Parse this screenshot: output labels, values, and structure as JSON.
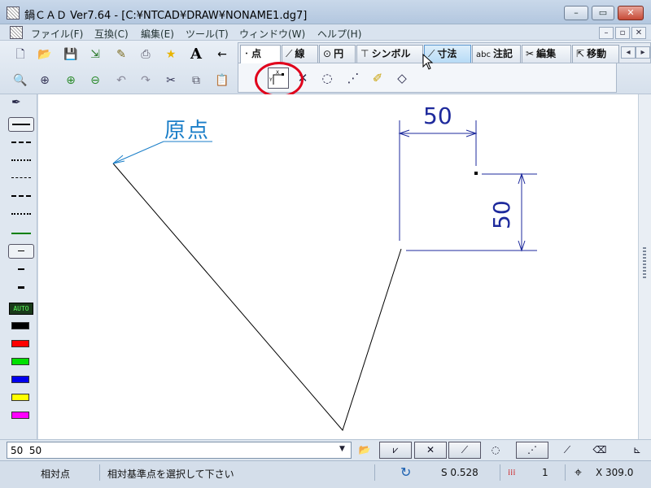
{
  "window": {
    "title": "鍋ＣＡＤ Ver7.64 - [C:¥NTCAD¥DRAW¥NONAME1.dg7]",
    "minimize": "–",
    "maximize": "▭",
    "close": "✕"
  },
  "menu": {
    "items": [
      "ファイル(F)",
      "互換(C)",
      "編集(E)",
      "ツール(T)",
      "ウィンドウ(W)",
      "ヘルプ(H)"
    ],
    "mdi_minimize": "–",
    "mdi_restore": "▫",
    "mdi_close": "✕"
  },
  "toolbar": {
    "text_icon": "A",
    "arrow_icon": "←"
  },
  "tabs": [
    {
      "label": "点",
      "glyph": "･"
    },
    {
      "label": "線",
      "glyph": "⟋"
    },
    {
      "label": "円",
      "glyph": "⊙"
    },
    {
      "label": "シンボル",
      "glyph": "⊤"
    },
    {
      "label": "寸法",
      "glyph": "⟋"
    },
    {
      "label": "注記",
      "glyph": "abc"
    },
    {
      "label": "編集",
      "glyph": "✂"
    },
    {
      "label": "移動",
      "glyph": "⇱"
    }
  ],
  "tab_scroll": {
    "left": "◂",
    "right": "▸"
  },
  "canvas": {
    "origin_label": "原点",
    "dim_horizontal": "50",
    "dim_vertical": "50"
  },
  "palette": {
    "auto_label": "AUTO",
    "colors": [
      "#000000",
      "#ff0000",
      "#00e000",
      "#0000ee",
      "#ffff00",
      "#ff00ff"
    ],
    "line_color_green": "#008000"
  },
  "command": {
    "value": "50  50",
    "dropdown": "▼"
  },
  "statusbar": {
    "mode": "相対点",
    "prompt": "相対基準点を選択して下さい",
    "scale": "S 0.528",
    "layer": "1",
    "coord": "X 309.0"
  }
}
